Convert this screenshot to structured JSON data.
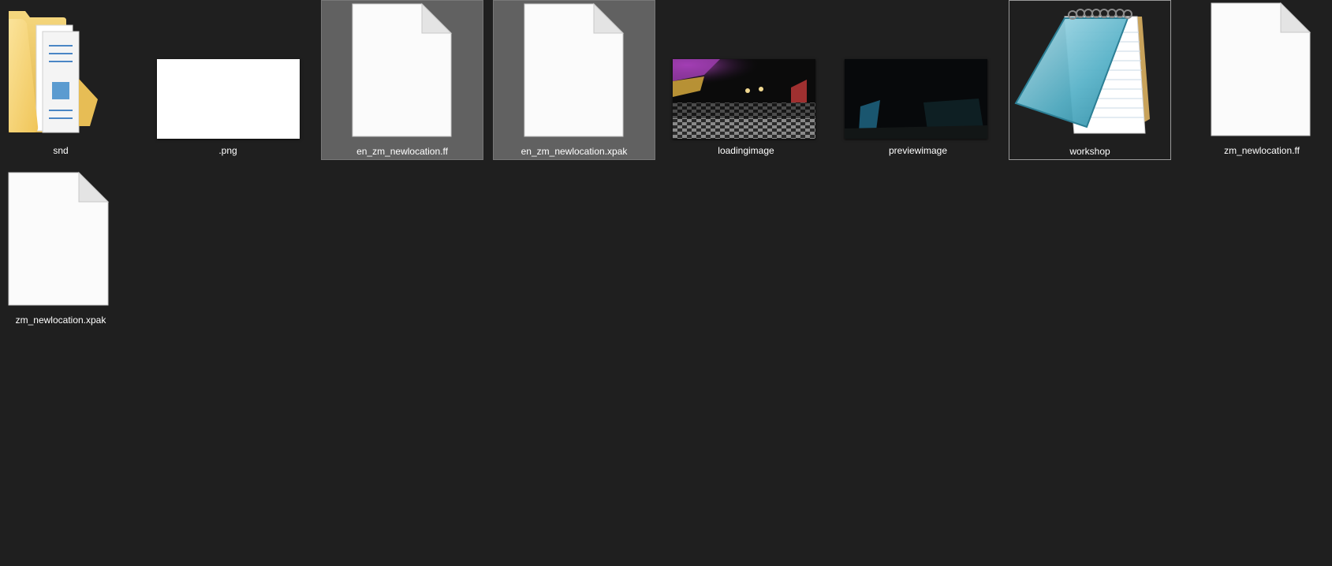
{
  "window": {
    "view": "Large icons",
    "background_color": "#1f1f1f"
  },
  "colors": {
    "selected_background": "#616161",
    "focus_border": "#999999",
    "label_text": "#ffffff"
  },
  "files": [
    {
      "name": "snd",
      "type": "folder",
      "icon": "folder-icon",
      "selected": false,
      "focused": false
    },
    {
      "name": ".png",
      "type": "image",
      "icon": "png-thumbnail",
      "selected": false,
      "focused": false
    },
    {
      "name": "en_zm_newlocation.ff",
      "type": "file",
      "icon": "blank-file-icon",
      "selected": true,
      "focused": false
    },
    {
      "name": "en_zm_newlocation.xpak",
      "type": "file",
      "icon": "blank-file-icon",
      "selected": true,
      "focused": false
    },
    {
      "name": "loadingimage",
      "type": "image",
      "icon": "loadingimage-thumbnail",
      "selected": false,
      "focused": false
    },
    {
      "name": "previewimage",
      "type": "image",
      "icon": "previewimage-thumbnail",
      "selected": false,
      "focused": false
    },
    {
      "name": "workshop",
      "type": "text",
      "icon": "notepad-icon",
      "selected": false,
      "focused": true
    },
    {
      "name": "zm_newlocation.ff",
      "type": "file",
      "icon": "blank-file-icon",
      "selected": false,
      "focused": false
    },
    {
      "name": "zm_newlocation.xpak",
      "type": "file",
      "icon": "blank-file-icon",
      "selected": false,
      "focused": false
    }
  ]
}
